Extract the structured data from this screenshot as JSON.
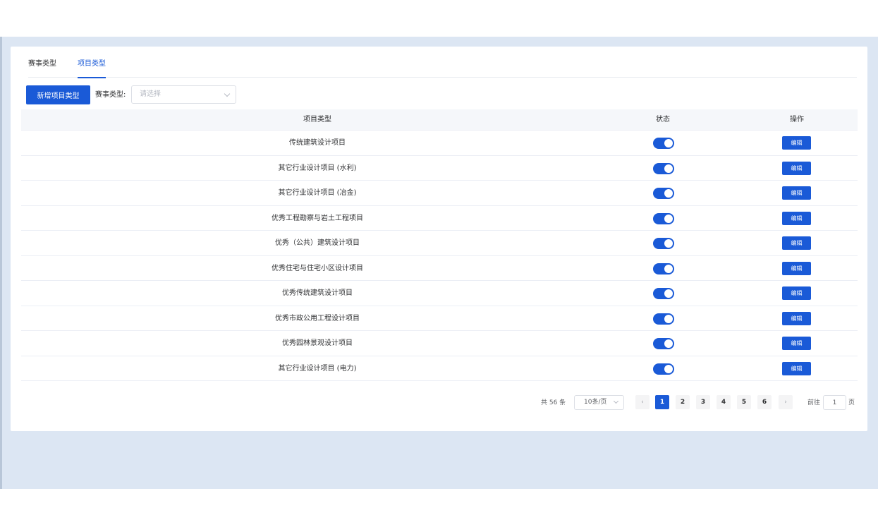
{
  "tabs": [
    {
      "label": "赛事类型",
      "active": false
    },
    {
      "label": "项目类型",
      "active": true
    }
  ],
  "toolbar": {
    "add_button": "新增项目类型",
    "filter_label": "赛事类型:",
    "filter_placeholder": "请选择"
  },
  "table": {
    "headers": {
      "name": "项目类型",
      "status": "状态",
      "operation": "操作"
    },
    "rows": [
      {
        "name": "传统建筑设计项目",
        "enabled": true,
        "edit": "编辑"
      },
      {
        "name": "其它行业设计项目 (水利)",
        "enabled": true,
        "edit": "编辑"
      },
      {
        "name": "其它行业设计项目 (冶金)",
        "enabled": true,
        "edit": "编辑"
      },
      {
        "name": "优秀工程勘察与岩土工程项目",
        "enabled": true,
        "edit": "编辑"
      },
      {
        "name": "优秀（公共）建筑设计项目",
        "enabled": true,
        "edit": "编辑"
      },
      {
        "name": "优秀住宅与住宅小区设计项目",
        "enabled": true,
        "edit": "编辑"
      },
      {
        "name": "优秀传统建筑设计项目",
        "enabled": true,
        "edit": "编辑"
      },
      {
        "name": "优秀市政公用工程设计项目",
        "enabled": true,
        "edit": "编辑"
      },
      {
        "name": "优秀园林景观设计项目",
        "enabled": true,
        "edit": "编辑"
      },
      {
        "name": "其它行业设计项目 (电力)",
        "enabled": true,
        "edit": "编辑"
      }
    ]
  },
  "pagination": {
    "total_text": "共 56 条",
    "page_size": "10条/页",
    "pages": [
      "1",
      "2",
      "3",
      "4",
      "5",
      "6"
    ],
    "current_page": "1",
    "goto_label": "前往",
    "goto_value": "1",
    "goto_suffix": "页"
  },
  "colors": {
    "primary": "#1a5ad7",
    "background": "#dce6f3"
  }
}
